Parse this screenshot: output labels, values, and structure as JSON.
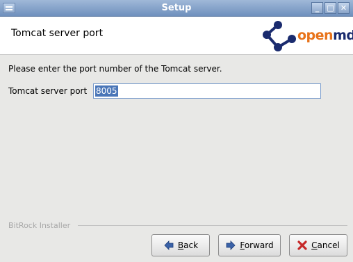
{
  "window": {
    "title": "Setup"
  },
  "header": {
    "page_title": "Tomcat server port",
    "logo_text_a": "open",
    "logo_text_b": "mdx"
  },
  "main": {
    "prompt": "Please enter the port number of the Tomcat server.",
    "port_label": "Tomcat server port",
    "port_value": "8005"
  },
  "footer": {
    "brand": "BitRock Installer"
  },
  "buttons": {
    "back": "Back",
    "forward": "Forward",
    "cancel": "Cancel"
  },
  "colors": {
    "logo_blue": "#1a2b6e",
    "logo_orange": "#e8731a",
    "title_gradient_top": "#9fb8d8",
    "selection": "#4a76b8"
  }
}
